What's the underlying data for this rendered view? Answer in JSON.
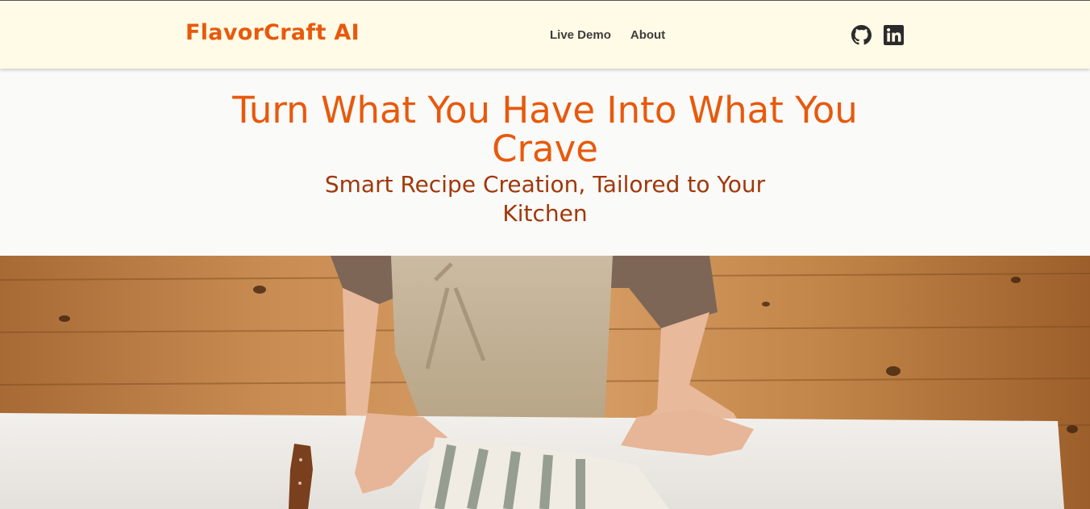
{
  "nav": {
    "brand": "FlavorCraft AI",
    "links": [
      {
        "label": "Live Demo"
      },
      {
        "label": "About"
      }
    ],
    "social": [
      {
        "icon": "github-icon"
      },
      {
        "icon": "linkedin-icon"
      }
    ]
  },
  "hero": {
    "title": "Turn What You Have Into What You Crave",
    "subtitle": "Smart Recipe Creation, Tailored to Your Kitchen"
  },
  "colors": {
    "accent": "#e8590c",
    "subtitle": "#a0380a",
    "nav_bg": "#fffbe6",
    "page_bg": "#fafaf8",
    "nav_text": "#3d3d3d"
  }
}
